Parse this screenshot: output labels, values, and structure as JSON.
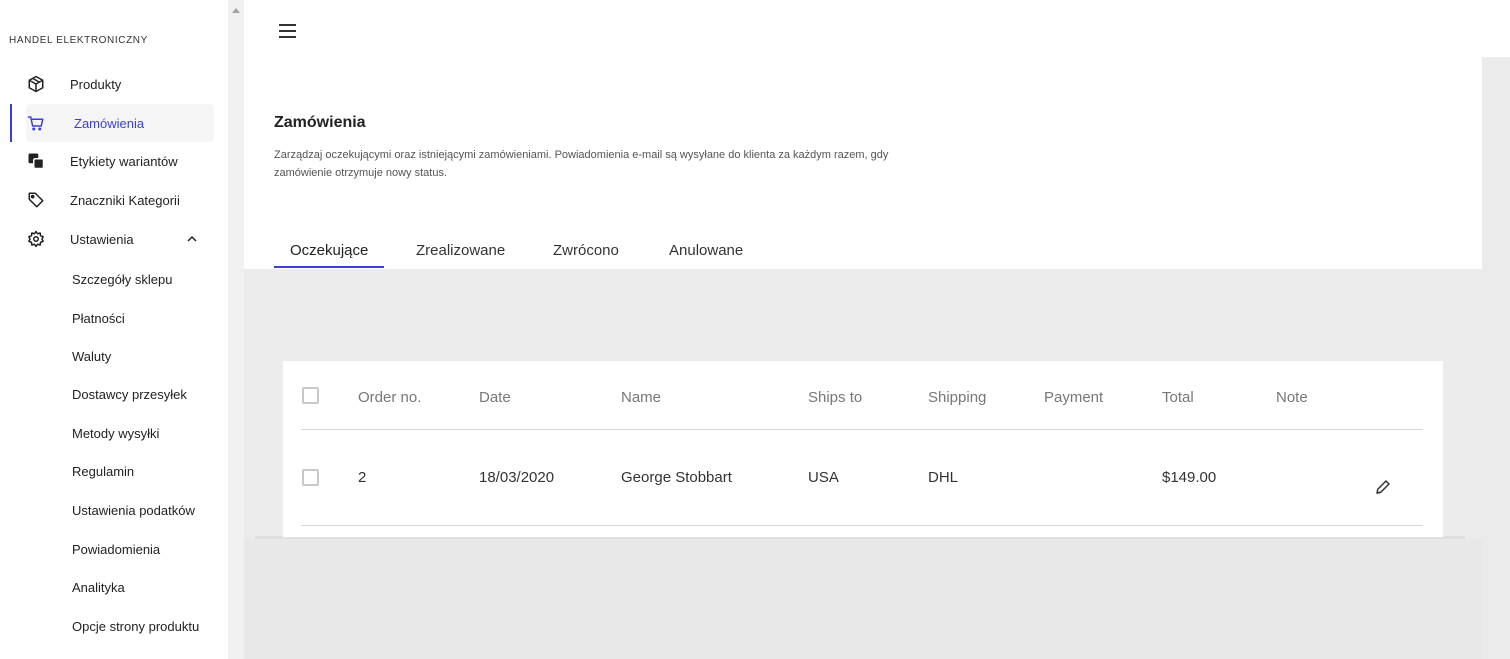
{
  "sidebar": {
    "brand": "HANDEL ELEKTRONICZNY",
    "items": [
      {
        "label": "Produkty",
        "icon": "package-icon"
      },
      {
        "label": "Zamówienia",
        "icon": "cart-icon",
        "active": true
      },
      {
        "label": "Etykiety wariantów",
        "icon": "layers-icon"
      },
      {
        "label": "Znaczniki Kategorii",
        "icon": "tag-icon"
      },
      {
        "label": "Ustawienia",
        "icon": "gear-icon",
        "expanded": true
      }
    ],
    "sub_items": [
      "Szczegóły sklepu",
      "Płatności",
      "Waluty",
      "Dostawcy przesyłek",
      "Metody wysyłki",
      "Regulamin",
      "Ustawienia podatków",
      "Powiadomienia",
      "Analityka",
      "Opcje strony produktu"
    ]
  },
  "header": {
    "title": "Zamówienia",
    "description": "Zarządzaj oczekującymi oraz istniejącymi zamówieniami. Powiadomienia e-mail są wysyłane do klienta za każdym razem, gdy zamówienie otrzymuje nowy status."
  },
  "tabs": [
    {
      "label": "Oczekujące",
      "active": true
    },
    {
      "label": "Zrealizowane"
    },
    {
      "label": "Zwrócono"
    },
    {
      "label": "Anulowane"
    }
  ],
  "table": {
    "columns": [
      "Order no.",
      "Date",
      "Name",
      "Ships to",
      "Shipping",
      "Payment",
      "Total",
      "Note"
    ],
    "rows": [
      {
        "order_no": "2",
        "date": "18/03/2020",
        "name": "George Stobbart",
        "ships_to": "USA",
        "shipping": "DHL",
        "payment": "",
        "total": "$149.00",
        "note": ""
      }
    ]
  },
  "colors": {
    "accent": "#3b3fd8",
    "content_bg": "#ececec",
    "card_bg": "#ffffff"
  }
}
